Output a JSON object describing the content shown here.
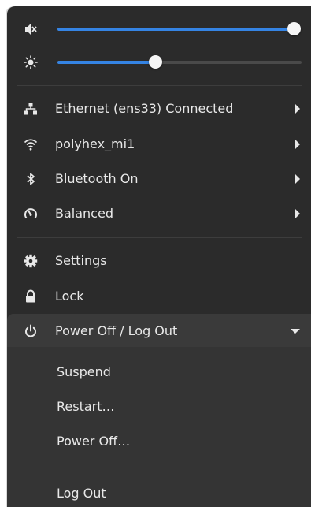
{
  "sliders": {
    "volume": {
      "icon": "volume-muted-icon",
      "level": 1.0
    },
    "brightness": {
      "icon": "brightness-icon",
      "level": 0.4
    }
  },
  "menu": {
    "ethernet": {
      "label": "Ethernet (ens33) Connected",
      "icon": "network-wired-icon"
    },
    "wifi": {
      "label": "polyhex_mi1",
      "icon": "wifi-icon"
    },
    "bluetooth": {
      "label": "Bluetooth On",
      "icon": "bluetooth-icon"
    },
    "power_mode": {
      "label": "Balanced",
      "icon": "power-profile-icon"
    },
    "settings": {
      "label": "Settings",
      "icon": "gear-icon"
    },
    "lock": {
      "label": "Lock",
      "icon": "lock-icon"
    },
    "power": {
      "label": "Power Off / Log Out",
      "icon": "power-icon"
    }
  },
  "power_submenu": {
    "suspend": "Suspend",
    "restart": "Restart…",
    "power_off": "Power Off…",
    "log_out": "Log Out"
  },
  "colors": {
    "accent": "#3584e4",
    "panel": "#2b2b2b",
    "text": "#e8e8e8"
  }
}
